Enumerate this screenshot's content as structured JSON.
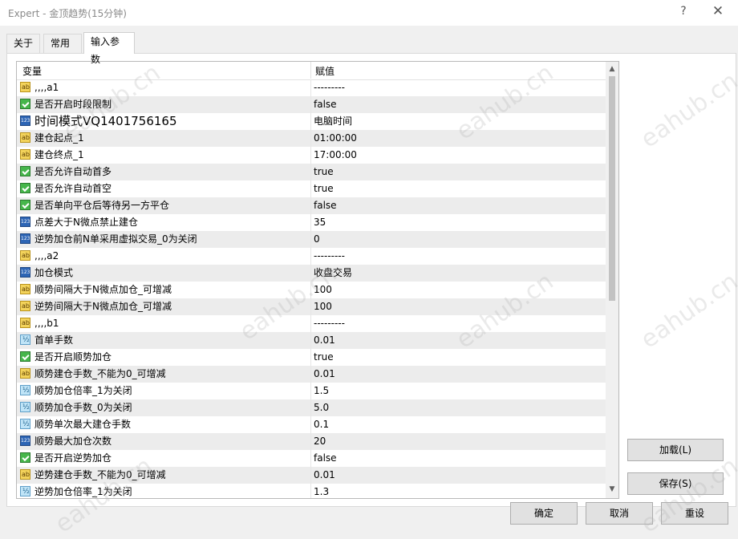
{
  "window": {
    "title": "Expert - 金顶趋势(15分钟)",
    "help_glyph": "?",
    "close_glyph": "✕"
  },
  "tabs": [
    {
      "label": "关于"
    },
    {
      "label": "常用"
    },
    {
      "label": "输入参数"
    }
  ],
  "table": {
    "col_variable": "变量",
    "col_value": "赋值",
    "rows": [
      {
        "icon": "ab-icon",
        "name": ",,,,a1",
        "value": "---------"
      },
      {
        "icon": "bool-icon",
        "name": "是否开启时段限制",
        "value": "false"
      },
      {
        "icon": "int-icon",
        "name": "时间模式VQ1401756165",
        "value": "电脑时间"
      },
      {
        "icon": "ab-icon",
        "name": "建仓起点_1",
        "value": "01:00:00"
      },
      {
        "icon": "ab-icon",
        "name": "建仓终点_1",
        "value": "17:00:00"
      },
      {
        "icon": "bool-icon",
        "name": "是否允许自动首多",
        "value": "true"
      },
      {
        "icon": "bool-icon",
        "name": "是否允许自动首空",
        "value": "true"
      },
      {
        "icon": "bool-icon",
        "name": "是否单向平仓后等待另一方平仓",
        "value": "false"
      },
      {
        "icon": "int-icon",
        "name": "点差大于N微点禁止建仓",
        "value": "35"
      },
      {
        "icon": "int-icon",
        "name": "逆势加仓前N单采用虚拟交易_0为关闭",
        "value": "0"
      },
      {
        "icon": "ab-icon",
        "name": ",,,,a2",
        "value": "---------"
      },
      {
        "icon": "int-icon",
        "name": "加仓模式",
        "value": "收盘交易"
      },
      {
        "icon": "ab-icon",
        "name": "顺势间隔大于N微点加仓_可增减",
        "value": "100"
      },
      {
        "icon": "ab-icon",
        "name": "逆势间隔大于N微点加仓_可增减",
        "value": "100"
      },
      {
        "icon": "ab-icon",
        "name": ",,,,b1",
        "value": "---------"
      },
      {
        "icon": "dbl-icon",
        "name": "首单手数",
        "value": "0.01"
      },
      {
        "icon": "bool-icon",
        "name": "是否开启顺势加仓",
        "value": "true"
      },
      {
        "icon": "ab-icon",
        "name": "顺势建仓手数_不能为0_可增减",
        "value": "0.01"
      },
      {
        "icon": "dbl-icon",
        "name": "顺势加仓倍率_1为关闭",
        "value": "1.5"
      },
      {
        "icon": "dbl-icon",
        "name": "顺势加仓手数_0为关闭",
        "value": "5.0"
      },
      {
        "icon": "dbl-icon",
        "name": "顺势单次最大建仓手数",
        "value": "0.1"
      },
      {
        "icon": "int-icon",
        "name": "顺势最大加仓次数",
        "value": "20"
      },
      {
        "icon": "bool-icon",
        "name": "是否开启逆势加仓",
        "value": "false"
      },
      {
        "icon": "ab-icon",
        "name": "逆势建仓手数_不能为0_可增减",
        "value": "0.01"
      },
      {
        "icon": "dbl-icon",
        "name": "逆势加仓倍率_1为关闭",
        "value": "1.3"
      }
    ]
  },
  "side_buttons": {
    "load": "加载(L)",
    "save": "保存(S)"
  },
  "footer_buttons": {
    "ok": "确定",
    "cancel": "取消",
    "reset": "重设"
  },
  "watermark": "eahub.cn",
  "colors": {
    "row_alt": "#ececec",
    "bool_icon": "#46b64b",
    "ab_icon": "#f3d35b",
    "int_icon": "#2d65b5",
    "dbl_icon": "#bfe4f7"
  }
}
